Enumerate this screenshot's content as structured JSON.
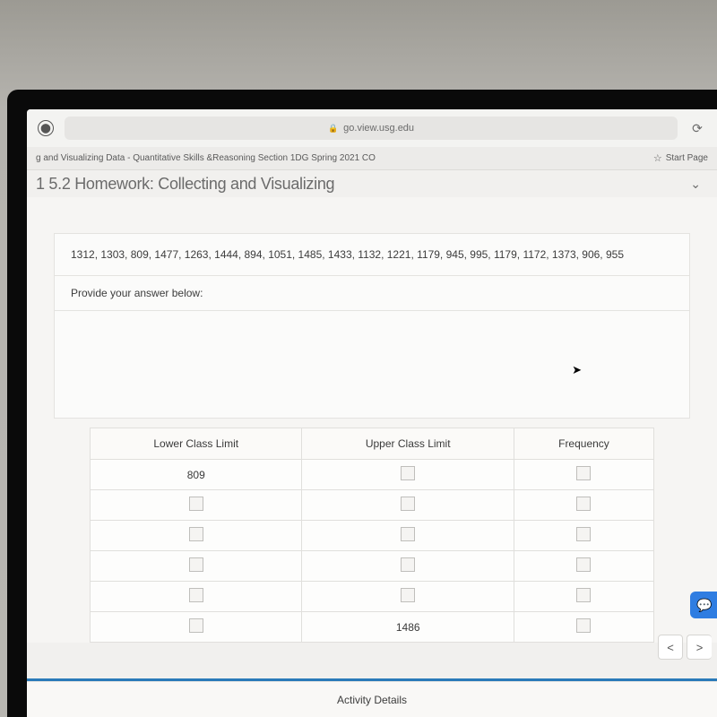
{
  "browser": {
    "url": "go.view.usg.edu",
    "tab_title_left": "g and Visualizing Data - Quantitative Skills &Reasoning Section 1DG Spring 2021 CO",
    "star_label": "Start Page"
  },
  "page": {
    "title_fragment": "1 5.2 Homework: Collecting and Visualizing"
  },
  "question": {
    "data_list": "1312, 1303, 809, 1477, 1263, 1444, 894, 1051, 1485, 1433, 1132, 1221, 1179, 945, 995, 1179, 1172, 1373,  906, 955",
    "prompt": "Provide your answer below:"
  },
  "table": {
    "headers": {
      "lower": "Lower Class Limit",
      "upper": "Upper Class Limit",
      "freq": "Frequency"
    },
    "rows": [
      {
        "lower": "809",
        "upper": "",
        "freq": ""
      },
      {
        "lower": "",
        "upper": "",
        "freq": ""
      },
      {
        "lower": "",
        "upper": "",
        "freq": ""
      },
      {
        "lower": "",
        "upper": "",
        "freq": ""
      },
      {
        "lower": "",
        "upper": "",
        "freq": ""
      },
      {
        "lower": "",
        "upper": "1486",
        "freq": ""
      }
    ]
  },
  "footer": {
    "activity": "Activity Details"
  }
}
